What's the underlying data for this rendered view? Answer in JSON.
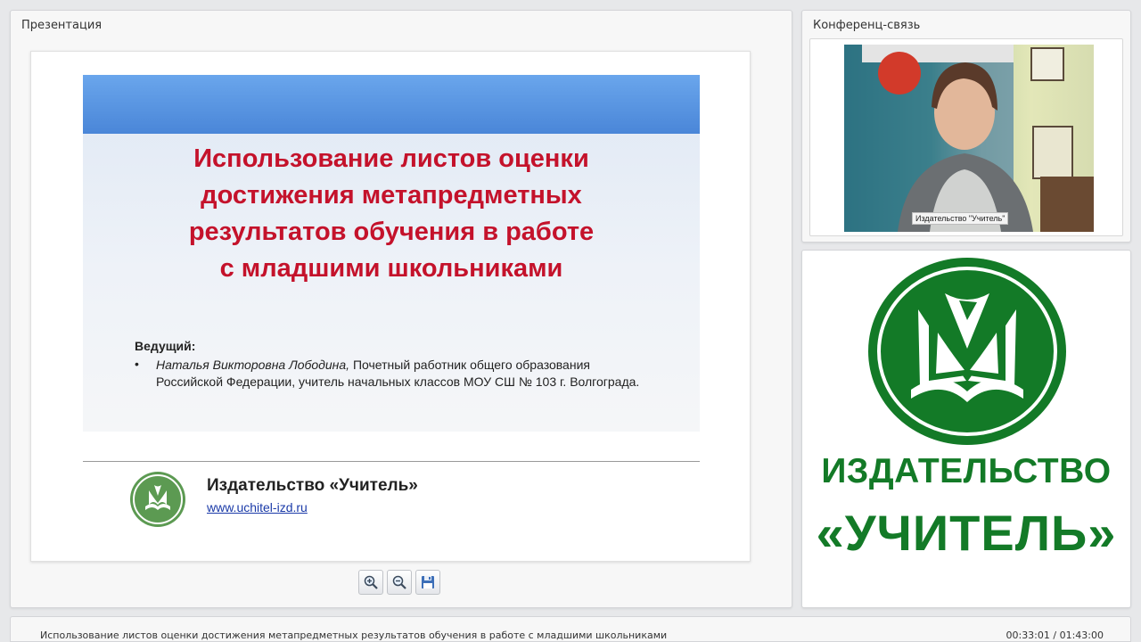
{
  "presentation_panel": {
    "title": "Презентация",
    "slide": {
      "title": "Использование листов оценки\nдостижения метапредметных\nрезультатов обучения в работе\nс младшими школьниками",
      "host_label": "Ведущий:",
      "host_bullet": "•",
      "host_name": "Наталья Викторовна Лободина,",
      "host_description": " Почетный работник общего образования Российской Федерации, учитель начальных классов МОУ СШ № 103 г. Волгограда.",
      "publisher_name": "Издательство «Учитель»",
      "publisher_url": "www.uchitel-izd.ru"
    },
    "toolbar": {
      "zoom_in_icon": "zoom-in-icon",
      "zoom_out_icon": "zoom-out-icon",
      "save_icon": "floppy-disk-icon"
    }
  },
  "conference_panel": {
    "title": "Конференц-связь",
    "video_label": "Издательство \"Учитель\""
  },
  "logo_panel": {
    "line1": "ИЗДАТЕЛЬСТВО",
    "line2": "«УЧИТЕЛЬ»"
  },
  "bottom_bar": {
    "title": "Использование листов оценки достижения метапредметных результатов обучения в работе с младшими школьниками",
    "time": "00:33:01 / 01:43:00"
  },
  "colors": {
    "slide_title": "#c4122b",
    "brand_green": "#137a27",
    "slide_band": "#4a86d8"
  }
}
